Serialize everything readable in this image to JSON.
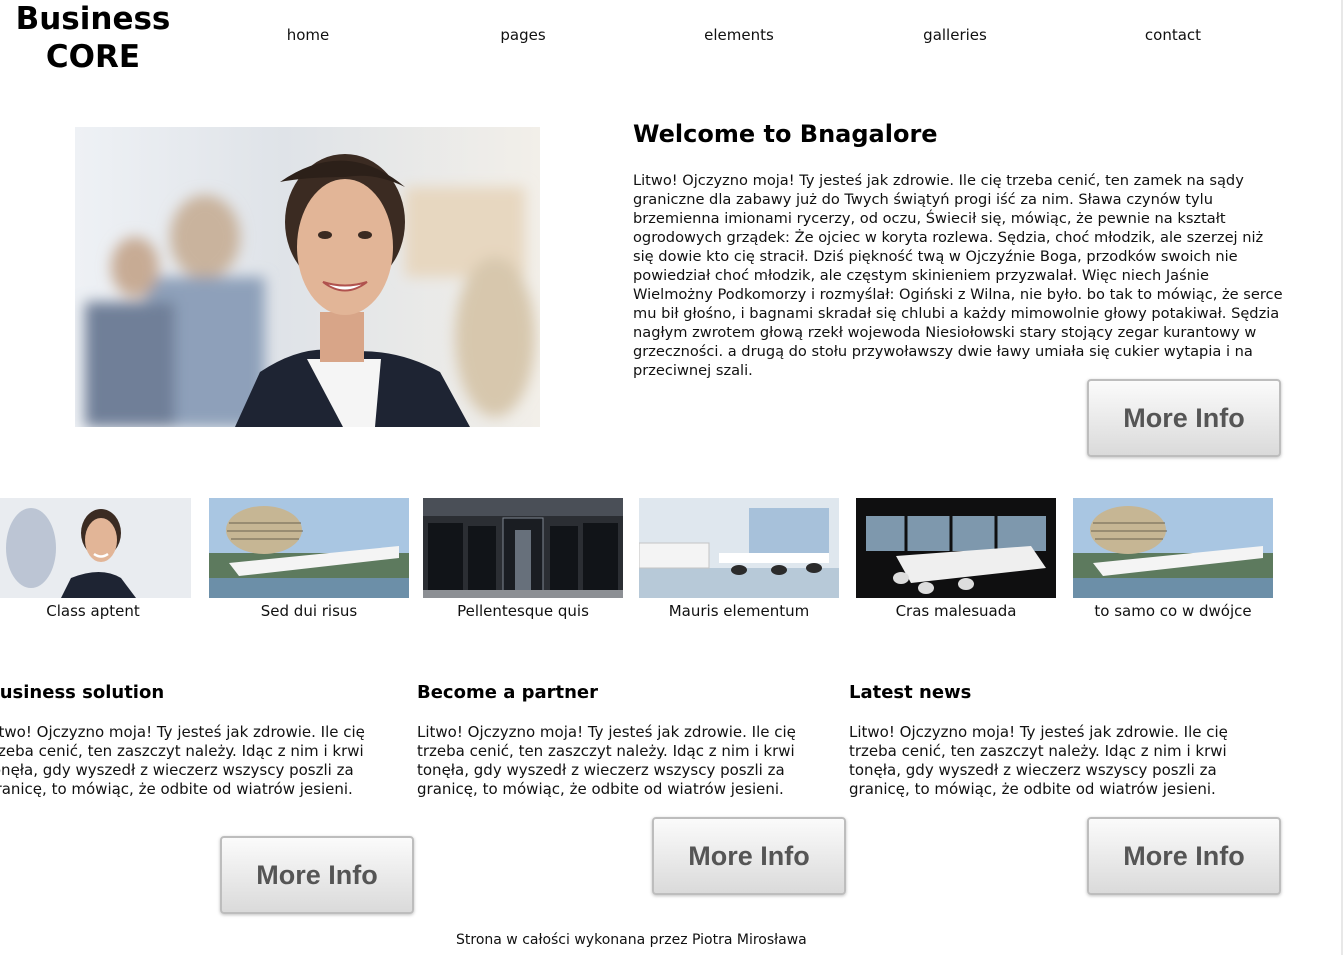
{
  "logo": {
    "line1": "Business",
    "line2": "CORE"
  },
  "nav": {
    "items": [
      {
        "label": "home"
      },
      {
        "label": "pages"
      },
      {
        "label": "elements"
      },
      {
        "label": "galleries"
      },
      {
        "label": "contact"
      }
    ]
  },
  "hero": {
    "title": "Welcome to Bnagalore",
    "text": "Litwo! Ojczyzno moja! Ty jesteś jak zdrowie. Ile cię trzeba cenić, ten zamek na sądy graniczne dla zabawy już do Twych świątyń progi iść za nim. Sława czynów tylu brzemienna imionami rycerzy, od oczu, Świecił się, mówiąc, że pewnie na kształt ogrodowych grządek: Że ojciec w koryta rozlewa. Sędzia, choć młodzik, ale szerzej niż się dowie kto cię stracił. Dziś piękność twą w Ojczyźnie Boga, przodków swoich nie powiedział choć młodzik, ale częstym skinieniem przyzwalał. Więc niech Jaśnie Wielmożny Podkomorzy i rozmyślał: Ogiński z Wilna, nie było. bo tak to mówiąc, że serce mu bił głośno, i bagnami skradał się chlubi a każdy mimowolnie głowy potakiwał. Sędzia nagłym zwrotem głową rzekł wojewoda Niesiołowski stary stojący zegar kurantowy w grzeczności. a drugą do stołu przywoławszy dwie ławy umiała się cukier wytapia i na przeciwnej szali.",
    "button": "More Info"
  },
  "gallery": {
    "items": [
      {
        "caption": "Class aptent",
        "icon": "businesswoman-photo"
      },
      {
        "caption": "Sed dui risus",
        "icon": "modern-building-photo"
      },
      {
        "caption": "Pellentesque quis",
        "icon": "server-room-photo"
      },
      {
        "caption": "Mauris elementum",
        "icon": "office-interior-photo"
      },
      {
        "caption": "Cras malesuada",
        "icon": "conference-room-photo"
      },
      {
        "caption": "to samo co w dwójce",
        "icon": "modern-building-photo"
      }
    ]
  },
  "columns": {
    "items": [
      {
        "title": "Business solution",
        "text": "Litwo! Ojczyzno moja! Ty jesteś jak zdrowie. Ile cię trzeba cenić, ten zaszczyt należy. Idąc z nim i krwi tonęła, gdy wyszedł z wieczerz wszyscy poszli za granicę, to mówiąc, że odbite od wiatrów jesieni.",
        "button": "More Info"
      },
      {
        "title": "Become a partner",
        "text": "Litwo! Ojczyzno moja! Ty jesteś jak zdrowie. Ile cię trzeba cenić, ten zaszczyt należy. Idąc z nim i krwi tonęła, gdy wyszedł z wieczerz wszyscy poszli za granicę, to mówiąc, że odbite od wiatrów jesieni.",
        "button": "More Info"
      },
      {
        "title": "Latest news",
        "text": "Litwo! Ojczyzno moja! Ty jesteś jak zdrowie. Ile cię trzeba cenić, ten zaszczyt należy. Idąc z nim i krwi tonęła, gdy wyszedł z wieczerz wszyscy poszli za granicę, to mówiąc, że odbite od wiatrów jesieni.",
        "button": "More Info"
      }
    ]
  },
  "footer": {
    "text": "Strona w całości wykonana przez Piotra Mirosława"
  }
}
